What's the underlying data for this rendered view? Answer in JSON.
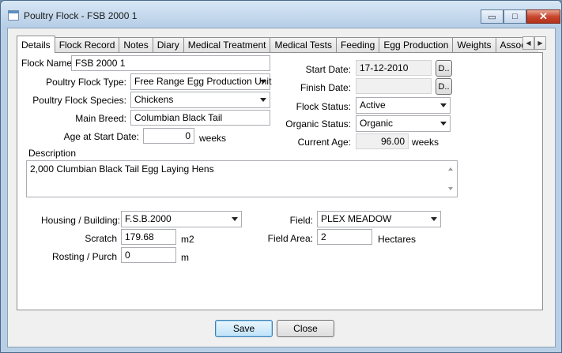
{
  "window": {
    "title": "Poultry Flock - FSB 2000 1",
    "minimize_glyph": "▭",
    "maximize_glyph": "□",
    "close_glyph": "✕"
  },
  "tabs": [
    "Details",
    "Flock Record",
    "Notes",
    "Diary",
    "Medical Treatment",
    "Medical Tests",
    "Feeding",
    "Egg Production",
    "Weights",
    "Associated D"
  ],
  "tab_scroll": {
    "left": "◀",
    "right": "▶"
  },
  "details": {
    "flock_name_label": "Flock Name:",
    "flock_name_value": "FSB 2000 1",
    "type_label": "Poultry Flock Type:",
    "type_value": "Free Range Egg Production Unit",
    "species_label": "Poultry Flock Species:",
    "species_value": "Chickens",
    "breed_label": "Main Breed:",
    "breed_value": "Columbian Black Tail",
    "age_start_label": "Age at Start Date:",
    "age_start_value": "0",
    "age_start_unit": "weeks",
    "start_date_label": "Start Date:",
    "start_date_value": "17-12-2010",
    "finish_date_label": "Finish Date:",
    "finish_date_value": "",
    "date_button_label": "D..",
    "status_label": "Flock Status:",
    "status_value": "Active",
    "organic_label": "Organic Status:",
    "organic_value": "Organic",
    "current_age_label": "Current Age:",
    "current_age_value": "96.00",
    "current_age_unit": "weeks",
    "description_label": "Description",
    "description_value": "2,000 Clumbian Black Tail Egg Laying Hens",
    "housing_label": "Housing / Building:",
    "housing_value": "F.S.B.2000",
    "scratch_label": "Scratch",
    "scratch_value": "179.68",
    "scratch_unit": "m2",
    "rosting_label": "Rosting / Purch",
    "rosting_value": "0",
    "rosting_unit": "m",
    "field_label": "Field:",
    "field_value": "PLEX MEADOW",
    "field_area_label": "Field Area:",
    "field_area_value": "2",
    "field_area_unit": "Hectares"
  },
  "buttons": {
    "save": "Save",
    "close": "Close"
  }
}
